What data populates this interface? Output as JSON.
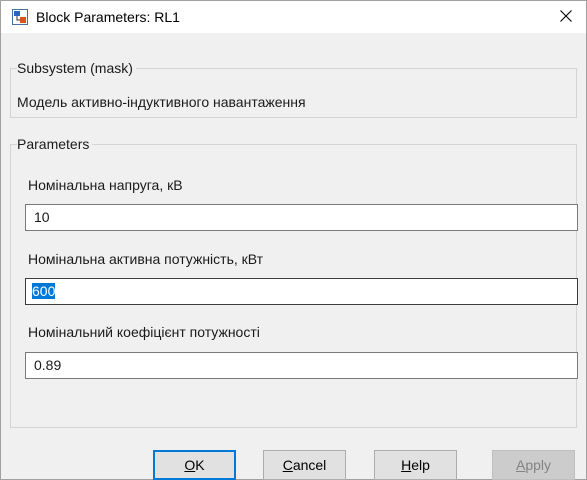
{
  "window": {
    "title": "Block Parameters: RL1",
    "icon": "simulink-block-icon",
    "close_icon": "close-icon"
  },
  "mask_group": {
    "legend": "Subsystem (mask)",
    "description": "Модель активно-індуктивного навантаження"
  },
  "parameters_group": {
    "legend": "Parameters",
    "fields": [
      {
        "label": "Номінальна напруга, кВ",
        "value": "10",
        "focused": false
      },
      {
        "label": "Номінальна активна потужність, кВт",
        "value": "600",
        "focused": true,
        "selected": true
      },
      {
        "label": "Номінальний коефіцієнт потужності",
        "value": "0.89",
        "focused": false
      }
    ]
  },
  "buttons": {
    "ok": {
      "mnemonic": "O",
      "rest": "K"
    },
    "cancel": {
      "mnemonic": "C",
      "rest": "ancel"
    },
    "help": {
      "mnemonic": "H",
      "rest": "elp"
    },
    "apply": {
      "mnemonic": "A",
      "rest": "pply",
      "disabled": true
    }
  },
  "colors": {
    "selection": "#0078d7",
    "default_button_border": "#0078d7",
    "dialog_background": "#f0f0f0"
  }
}
